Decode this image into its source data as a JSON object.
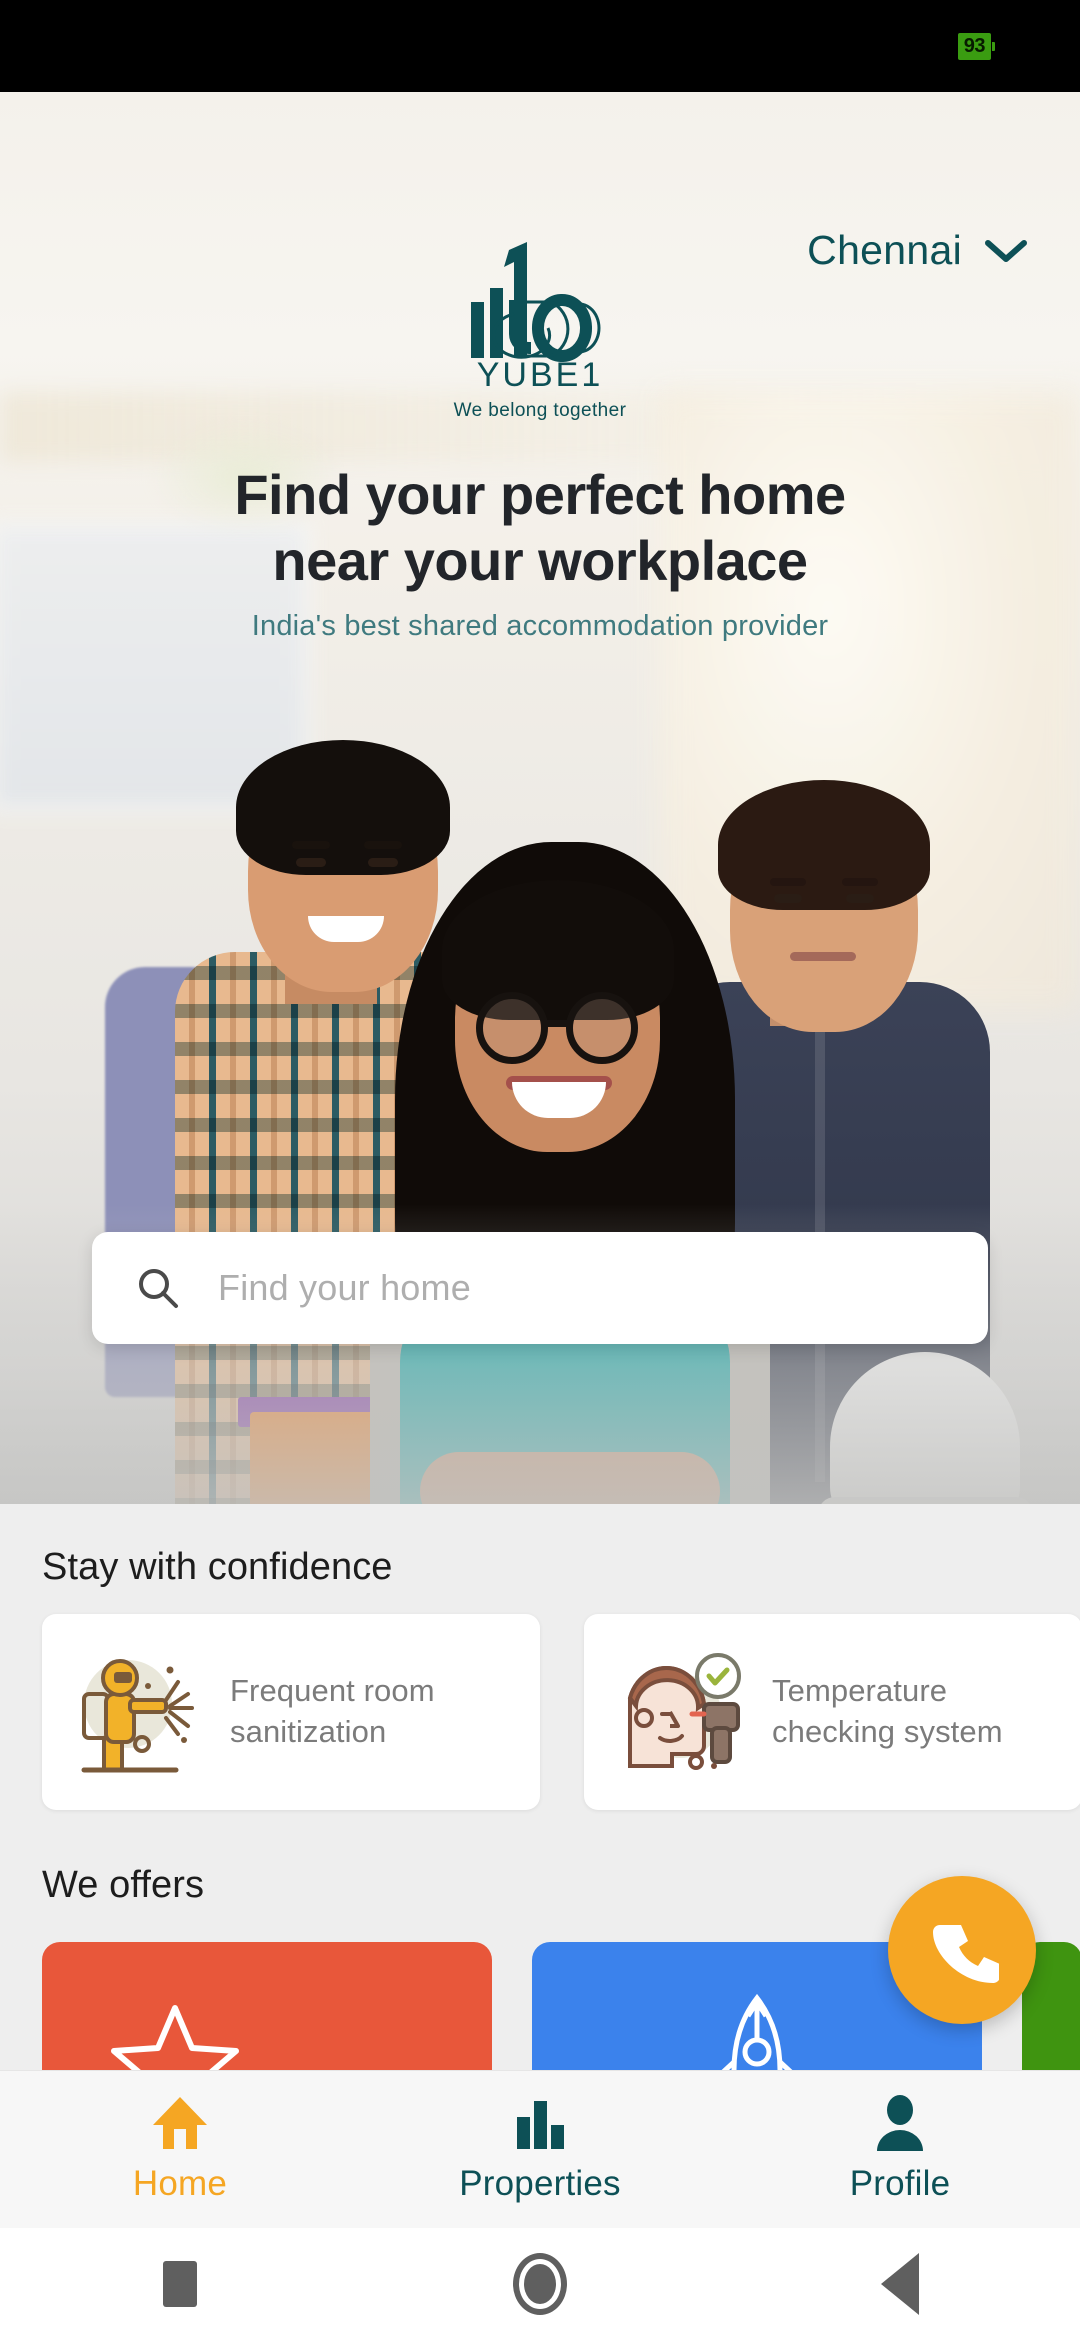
{
  "status_bar": {
    "battery_percent": "93"
  },
  "header": {
    "city": "Chennai",
    "city_chevron_icon": "chevron-down-icon",
    "logo_name": "YUBE1",
    "logo_tagline": "We belong together",
    "logo_mark_icon": "yube1-logo-icon"
  },
  "hero": {
    "headline_line1": "Find your perfect home",
    "headline_line2": "near your workplace",
    "subheadline": "India's best shared accommodation provider",
    "image_alt": "three-young-people-photo"
  },
  "search": {
    "placeholder": "Find your home",
    "icon": "search-icon"
  },
  "confidence": {
    "title": "Stay with confidence",
    "cards": [
      {
        "icon": "sanitization-worker-icon",
        "label": "Frequent room\nsanitization",
        "line1": "Frequent room",
        "line2": "sanitization"
      },
      {
        "icon": "thermometer-head-icon",
        "label": "Temperature\nchecking system",
        "line1": "Temperature",
        "line2": "checking system"
      }
    ]
  },
  "offers": {
    "title": "We offers",
    "cards": [
      {
        "icon": "star-badge-icon",
        "color": "#e8573a"
      },
      {
        "icon": "rocket-icon",
        "color": "#3b82ec"
      },
      {
        "icon": "",
        "color": "#3f9410"
      }
    ]
  },
  "fab": {
    "icon": "phone-icon",
    "color": "#f5a623"
  },
  "bottom_nav": {
    "active": "Home",
    "items": [
      {
        "label": "Home",
        "icon": "home-icon",
        "color": "#f5a623"
      },
      {
        "label": "Properties",
        "icon": "bar-chart-icon",
        "color": "#0d5056"
      },
      {
        "label": "Profile",
        "icon": "person-icon",
        "color": "#0d5056"
      }
    ]
  },
  "android_nav": {
    "items": [
      {
        "name": "recents-button",
        "icon": "square-icon"
      },
      {
        "name": "home-button",
        "icon": "circle-icon"
      },
      {
        "name": "back-button",
        "icon": "triangle-back-icon"
      }
    ]
  },
  "colors": {
    "brand_teal": "#0d5056",
    "accent_amber": "#f5a623",
    "offer_red": "#e8573a",
    "offer_blue": "#3b82ec",
    "offer_green": "#3f9410",
    "battery_green": "#3a9c11"
  }
}
